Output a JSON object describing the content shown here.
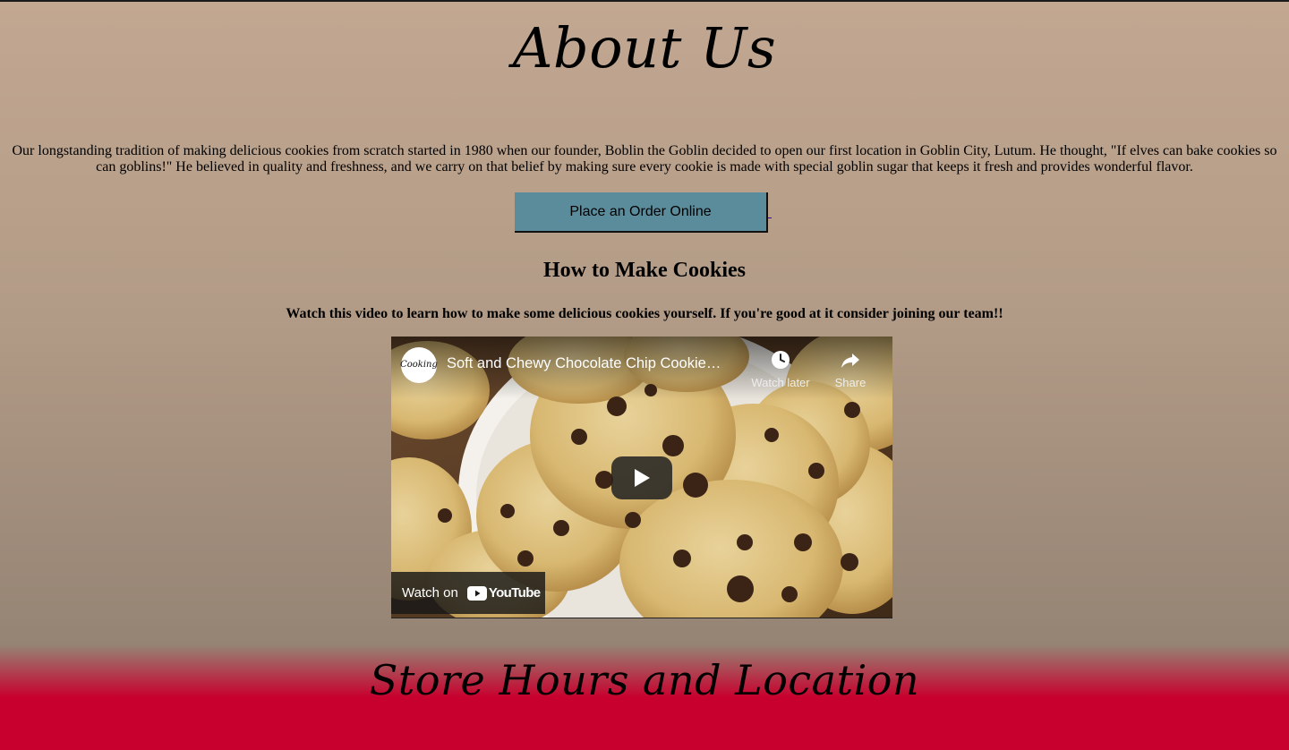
{
  "page": {
    "about_title": "About Us",
    "about_text": "Our longstanding tradition of making delicious cookies from scratch started in 1980 when our founder, Boblin the Goblin decided to open our first location in Goblin City, Lutum. He thought, \"If elves can bake cookies so can goblins!\" He believed in quality and freshness, and we carry on that belief by making sure every cookie is made with special goblin sugar that keeps it fresh and provides wonderful flavor.",
    "order_button_label": "Place an Order Online",
    "how_title": "How to Make Cookies",
    "how_subtitle": "Watch this video to learn how to make some delicious cookies yourself. If you're good at it consider joining our team!!",
    "store_title": "Store Hours and Location"
  },
  "video": {
    "channel_name": "Cooking",
    "title": "Soft and Chewy Chocolate Chip Cookie…",
    "watch_later_label": "Watch later",
    "share_label": "Share",
    "watch_on_label": "Watch on",
    "youtube_label": "YouTube",
    "icons": {
      "watch_later": "clock-icon",
      "share": "share-arrow-icon",
      "play": "play-icon",
      "youtube": "youtube-logo-icon"
    }
  },
  "colors": {
    "button_bg": "#5b8c9b",
    "footer_red": "#c8002e",
    "page_tan": "#c2a791",
    "youtube_red": "#ff0000"
  }
}
